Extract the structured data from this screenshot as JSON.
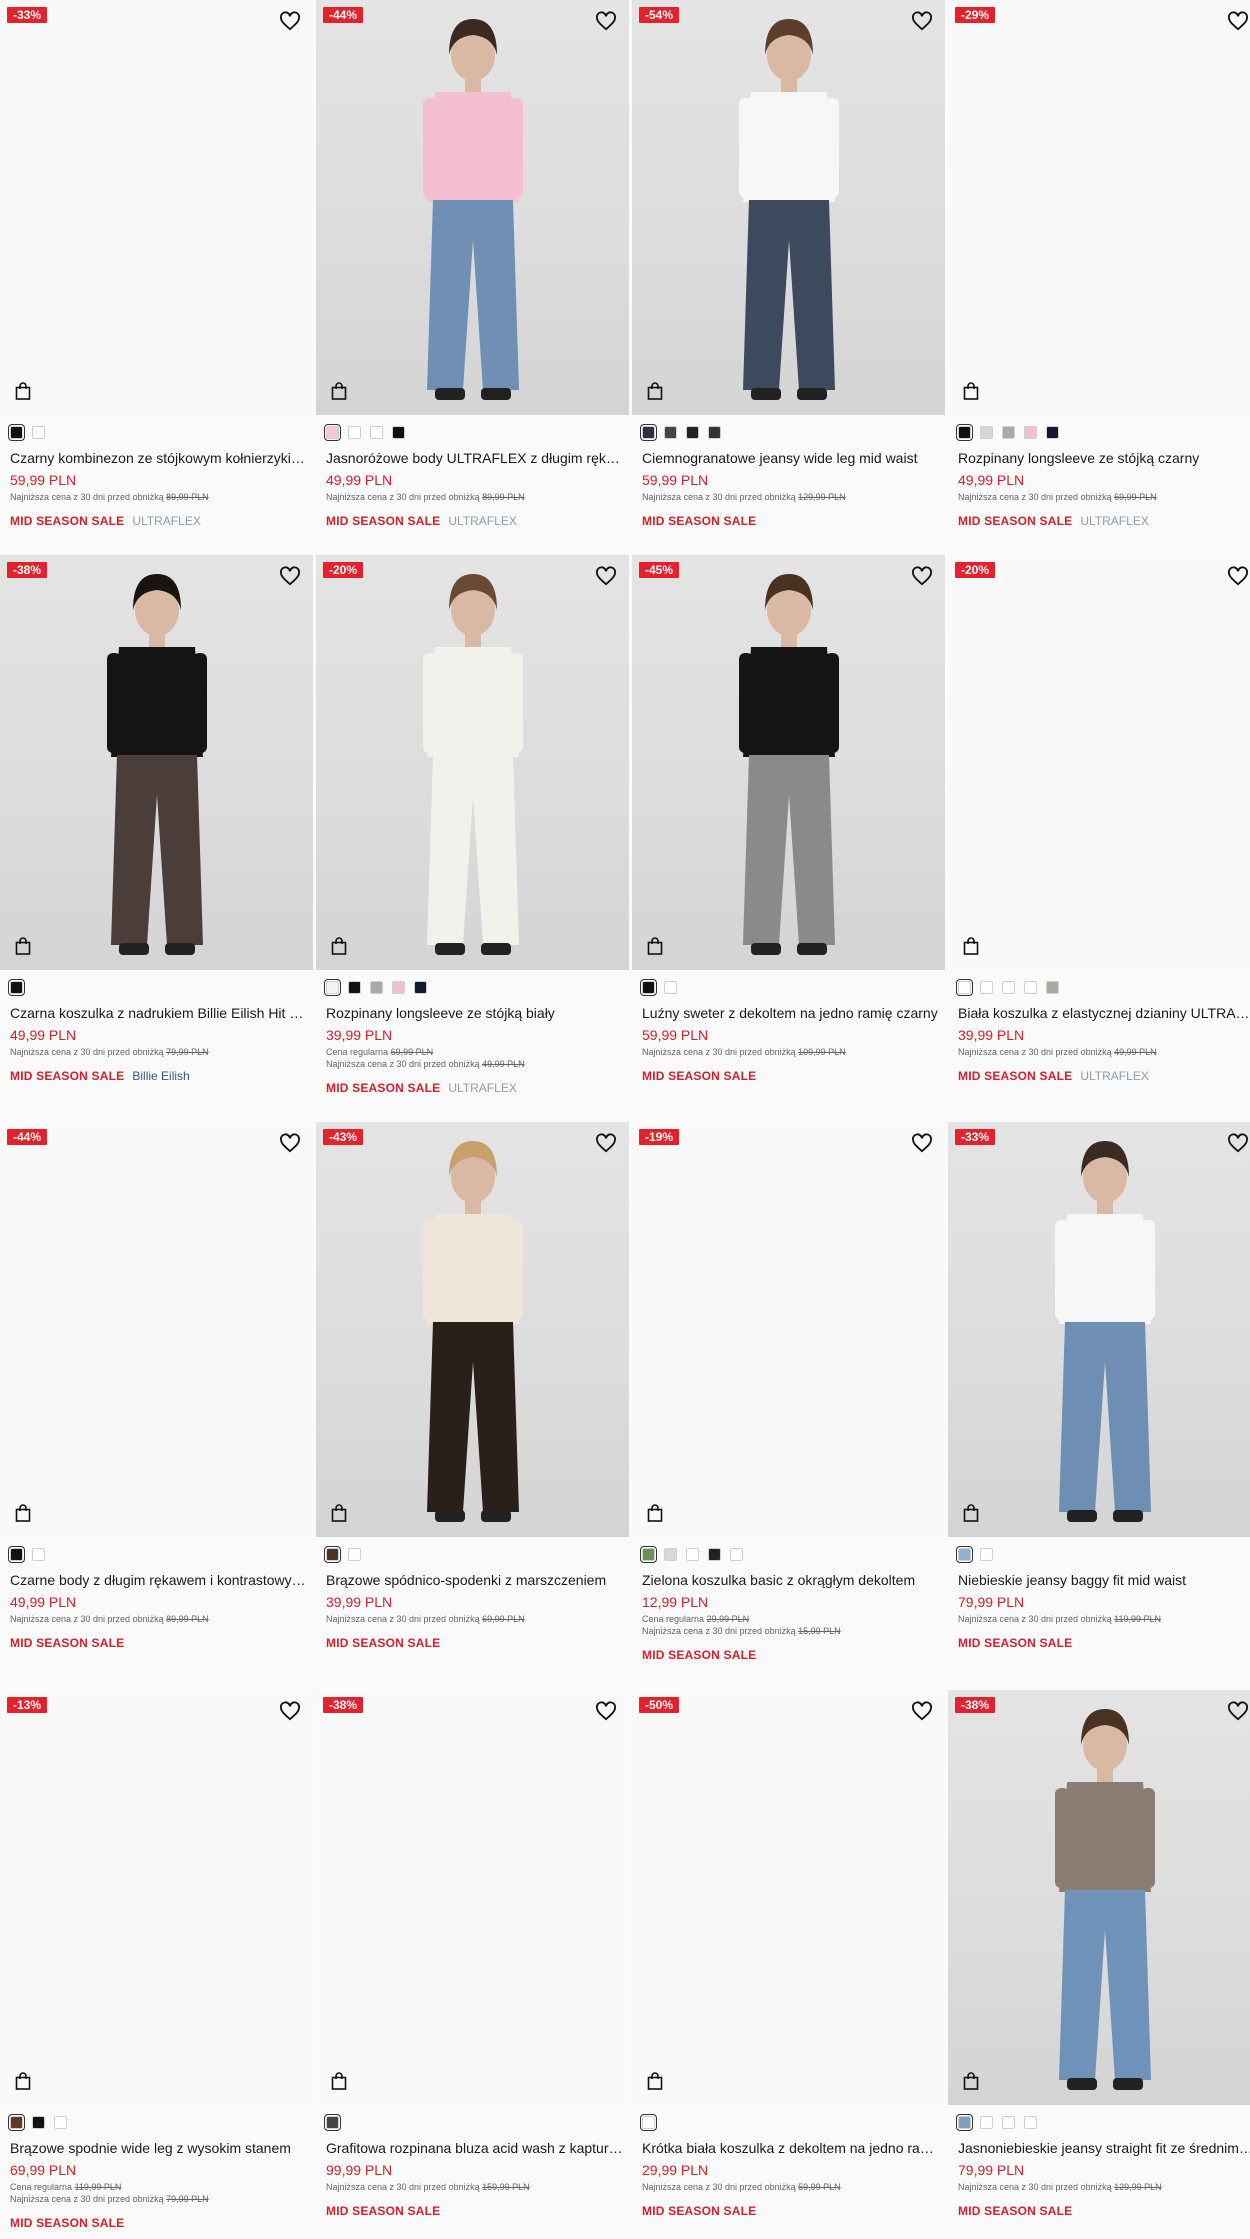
{
  "labels": {
    "sale_tag": "MID SEASON SALE",
    "lowest_prefix": "Najniższa cena z 30 dni przed obniżką",
    "regular_prefix": "Cena regularna"
  },
  "products": [
    {
      "discount": "-33%",
      "name": "Czarny kombinezon ze stójkowym kołnierzykiem ULTRAFLEX",
      "price": "59,99 PLN",
      "lowest": "89,99 PLN",
      "brand": "ULTRAFLEX",
      "swatches": [
        "#111111",
        "#ffffff"
      ]
    },
    {
      "discount": "-44%",
      "name": "Jasnoróżowe body ULTRAFLEX z długim rękawem",
      "price": "49,99 PLN",
      "lowest": "89,99 PLN",
      "brand": "ULTRAFLEX",
      "swatches": [
        "#f3c7d3",
        "#ffffff",
        "#ffffff",
        "#111111"
      ]
    },
    {
      "discount": "-54%",
      "name": "Ciemnogranatowe jeansy wide leg mid waist",
      "price": "59,99 PLN",
      "lowest": "129,99 PLN",
      "brand": "",
      "swatches": [
        "#2b3140",
        "#444444",
        "#222222",
        "#333333"
      ]
    },
    {
      "discount": "-29%",
      "name": "Rozpinany longsleeve ze stójką czarny",
      "price": "49,99 PLN",
      "lowest": "69,99 PLN",
      "brand": "ULTRAFLEX",
      "swatches": [
        "#111111",
        "#d8d6d0",
        "#a9a9a9",
        "#f2c1cb",
        "#0f1a2e"
      ]
    },
    {
      "discount": "-38%",
      "name": "Czarna koszulka z nadrukiem Billie Eilish Hit Me Hard and Soft",
      "price": "49,99 PLN",
      "lowest": "79,99 PLN",
      "brand": "Billie Eilish",
      "swatches": [
        "#111111"
      ]
    },
    {
      "discount": "-20%",
      "name": "Rozpinany longsleeve ze stójką biały",
      "price": "39,99 PLN",
      "regular": "69,99 PLN",
      "lowest": "49,99 PLN",
      "brand": "ULTRAFLEX",
      "swatches": [
        "#f3f3f3",
        "#111111",
        "#a9a9a9",
        "#f2c1cb",
        "#0f1a2e"
      ]
    },
    {
      "discount": "-45%",
      "name": "Luźny sweter z dekoltem na jedno ramię czarny",
      "price": "59,99 PLN",
      "lowest": "109,99 PLN",
      "brand": "",
      "swatches": [
        "#111111",
        "#ffffff"
      ]
    },
    {
      "discount": "-20%",
      "name": "Biała koszulka z elastycznej dzianiny ULTRAFLEX",
      "price": "39,99 PLN",
      "lowest": "49,99 PLN",
      "brand": "ULTRAFLEX",
      "swatches": [
        "#ffffff",
        "#ffffff",
        "#ffffff",
        "#ffffff",
        "#a8a8a0"
      ]
    },
    {
      "discount": "-44%",
      "name": "Czarne body z długim rękawem i kontrastowym obszyciem",
      "price": "49,99 PLN",
      "lowest": "89,99 PLN",
      "brand": "",
      "swatches": [
        "#111111",
        "#ffffff"
      ]
    },
    {
      "discount": "-43%",
      "name": "Brązowe spódnico-spodenki z marszczeniem",
      "price": "39,99 PLN",
      "lowest": "69,99 PLN",
      "brand": "",
      "swatches": [
        "#4a3226",
        "#ffffff"
      ]
    },
    {
      "discount": "-19%",
      "name": "Zielona koszulka basic z okrągłym dekoltem",
      "price": "12,99 PLN",
      "regular": "29,99 PLN",
      "lowest": "15,99 PLN",
      "brand": "",
      "swatches": [
        "#6b8f5a",
        "#d8d8d8",
        "#ffffff",
        "#222222",
        "#ffffff"
      ]
    },
    {
      "discount": "-33%",
      "name": "Niebieskie jeansy baggy fit mid waist",
      "price": "79,99 PLN",
      "lowest": "119,99 PLN",
      "brand": "",
      "swatches": [
        "#8fb0cf",
        "#ffffff"
      ]
    },
    {
      "discount": "-13%",
      "name": "Brązowe spodnie wide leg z wysokim stanem",
      "price": "69,99 PLN",
      "regular": "119,99 PLN",
      "lowest": "79,99 PLN",
      "brand": "",
      "swatches": [
        "#5a3b2a",
        "#111111",
        "#ffffff"
      ]
    },
    {
      "discount": "-38%",
      "name": "Grafitowa rozpinana bluza acid wash z kapturem",
      "price": "99,99 PLN",
      "lowest": "159,99 PLN",
      "brand": "",
      "swatches": [
        "#444444"
      ]
    },
    {
      "discount": "-50%",
      "name": "Krótka biała koszulka z dekoltem na jedno ramię",
      "price": "29,99 PLN",
      "lowest": "59,99 PLN",
      "brand": "",
      "swatches": [
        "#ffffff"
      ]
    },
    {
      "discount": "-38%",
      "name": "Jasnoniebieskie jeansy straight fit ze średnim stanem",
      "price": "79,99 PLN",
      "lowest": "129,99 PLN",
      "brand": "",
      "swatches": [
        "#7f9fbf",
        "#ffffff",
        "#ffffff",
        "#ffffff"
      ]
    }
  ]
}
